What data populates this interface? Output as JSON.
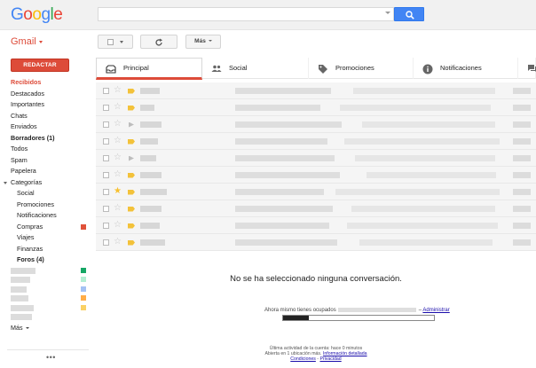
{
  "logo": {
    "letters": [
      "G",
      "o",
      "o",
      "g",
      "l",
      "e"
    ],
    "colors": [
      "#4285f4",
      "#ea4335",
      "#fbbc05",
      "#4285f4",
      "#34a853",
      "#ea4335"
    ]
  },
  "search": {
    "value": "",
    "placeholder": ""
  },
  "app": {
    "label": "Gmail"
  },
  "toolbar": {
    "more_label": "Más"
  },
  "compose": {
    "label": "REDACTAR"
  },
  "sidebar": {
    "items": [
      {
        "label": "Recibidos",
        "style": "active"
      },
      {
        "label": "Destacados"
      },
      {
        "label": "Importantes"
      },
      {
        "label": "Chats"
      },
      {
        "label": "Enviados"
      },
      {
        "label": "Borradores (1)",
        "style": "bold"
      },
      {
        "label": "Todos"
      },
      {
        "label": "Spam"
      },
      {
        "label": "Papelera"
      }
    ],
    "categories_label": "Categorías",
    "categories": [
      {
        "label": "Social"
      },
      {
        "label": "Promociones"
      },
      {
        "label": "Notificaciones"
      },
      {
        "label": "Compras",
        "color": "#e0523a"
      },
      {
        "label": "Viajes"
      },
      {
        "label": "Finanzas"
      },
      {
        "label": "Foros (4)",
        "style": "bold"
      }
    ],
    "label_colors": [
      "#16a765",
      "#b3efd3",
      "#a4c2f4",
      "#ffad47",
      "#fad165"
    ],
    "more_label": "Más"
  },
  "tabs": [
    {
      "label": "Principal",
      "icon": "inbox-icon",
      "active": true
    },
    {
      "label": "Social",
      "icon": "people-icon"
    },
    {
      "label": "Promociones",
      "icon": "tag-icon"
    },
    {
      "label": "Notificaciones",
      "icon": "info-icon"
    },
    {
      "label": "",
      "icon": "forum-icon"
    }
  ],
  "emails": [
    {
      "starred": false,
      "important": true
    },
    {
      "starred": false,
      "important": true
    },
    {
      "starred": false,
      "important": false
    },
    {
      "starred": false,
      "important": true
    },
    {
      "starred": false,
      "important": false
    },
    {
      "starred": false,
      "important": true
    },
    {
      "starred": true,
      "important": true
    },
    {
      "starred": false,
      "important": true
    },
    {
      "starred": false,
      "important": true
    },
    {
      "starred": false,
      "important": true
    }
  ],
  "reading_pane": {
    "empty_message": "No se ha seleccionado ninguna conversación."
  },
  "storage": {
    "prefix": "Ahora mismo tienes ocupados",
    "manage_label": "Administrar",
    "used_fraction": 0.17
  },
  "footer": {
    "last_activity": "Última actividad de la cuenta: hace 0 minutos",
    "open_in": "Abierta en 1 ubicación más",
    "details_link": "Información detallada",
    "terms_link": "Condiciones",
    "privacy_link": "Privacidad"
  }
}
